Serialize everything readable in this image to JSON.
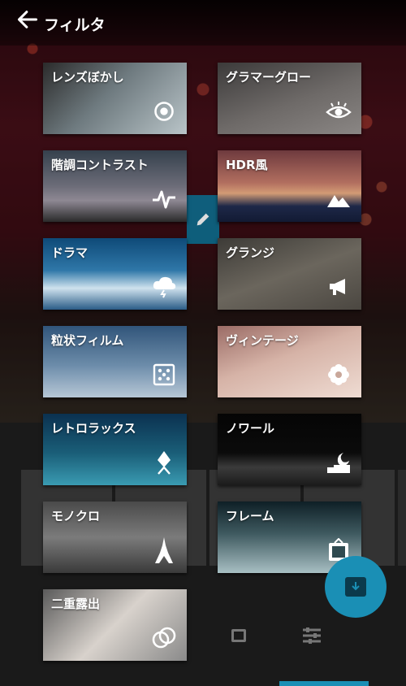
{
  "header": {
    "title": "フィルタ",
    "back_icon": "arrow-left-icon"
  },
  "filters": [
    {
      "label": "レンズぼかし",
      "icon": "target-icon"
    },
    {
      "label": "グラマーグロー",
      "icon": "eye-icon"
    },
    {
      "label": "階調コントラスト",
      "icon": "pulse-icon"
    },
    {
      "label": "HDR風",
      "icon": "mountain-icon"
    },
    {
      "label": "ドラマ",
      "icon": "storm-cloud-icon"
    },
    {
      "label": "グランジ",
      "icon": "megaphone-icon"
    },
    {
      "label": "粒状フィルム",
      "icon": "dice-icon"
    },
    {
      "label": "ヴィンテージ",
      "icon": "flower-icon"
    },
    {
      "label": "レトロラックス",
      "icon": "drop-icon"
    },
    {
      "label": "ノワール",
      "icon": "night-icon"
    },
    {
      "label": "モノクロ",
      "icon": "tower-icon"
    },
    {
      "label": "フレーム",
      "icon": "frame-icon"
    },
    {
      "label": "二重露出",
      "icon": "double-circle-icon"
    }
  ],
  "colors": {
    "accent": "#1a8fb5"
  }
}
